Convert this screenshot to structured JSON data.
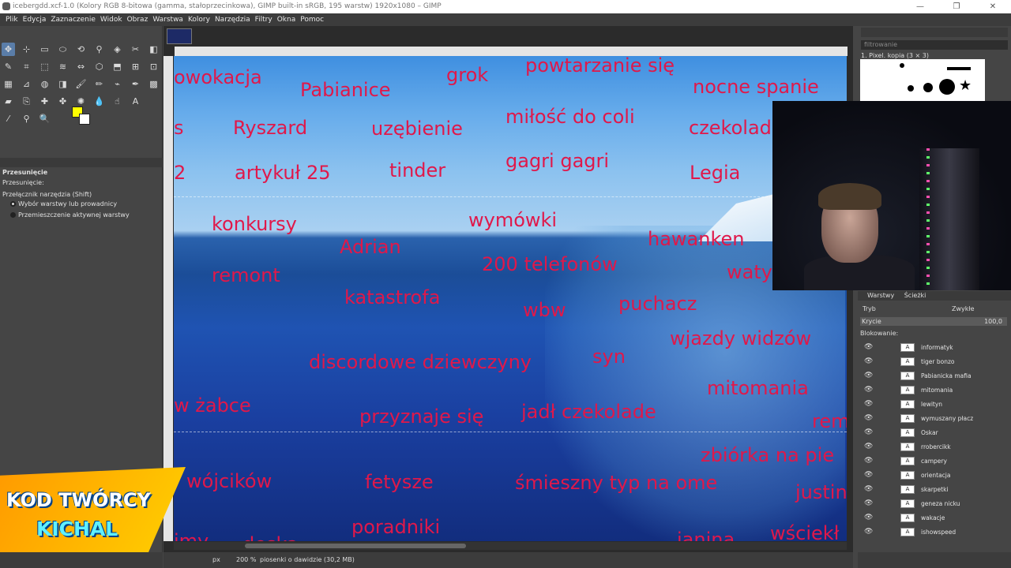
{
  "window": {
    "title": "icebergdd.xcf-1.0 (Kolory RGB 8-bitowa (gamma, stałoprzecinkowa), GIMP built-in sRGB, 195 warstw) 1920x1080 – GIMP",
    "minimize": "—",
    "maximize": "❐",
    "close": "✕"
  },
  "menu": [
    "Plik",
    "Edycja",
    "Zaznaczenie",
    "Widok",
    "Obraz",
    "Warstwa",
    "Kolory",
    "Narzędzia",
    "Filtry",
    "Okna",
    "Pomoc"
  ],
  "tool_options": {
    "title": "Przesunięcie",
    "move_label": "Przesunięcie:",
    "toggle_label": "Przełącznik narzędzia  (Shift)",
    "option1": "Wybór warstwy lub prowadnicy",
    "option2": "Przemieszczenie aktywnej warstwy"
  },
  "colors": {
    "foreground": "#ffff00",
    "background": "#ffffff",
    "text_red": "#e0184a"
  },
  "canvas_words": [
    {
      "t": "owokacja",
      "size": 24
    },
    {
      "t": "Pabianice",
      "size": 24
    },
    {
      "t": "grok",
      "size": 24
    },
    {
      "t": "powtarzanie się",
      "size": 24
    },
    {
      "t": "nocne spanie",
      "size": 24
    },
    {
      "t": "s",
      "size": 24
    },
    {
      "t": "Ryszard",
      "size": 24
    },
    {
      "t": "uzębienie",
      "size": 24
    },
    {
      "t": "miłość do coli",
      "size": 24
    },
    {
      "t": "czekolad",
      "size": 24
    },
    {
      "t": "2",
      "size": 24
    },
    {
      "t": "artykuł 25",
      "size": 24
    },
    {
      "t": "tinder",
      "size": 24
    },
    {
      "t": "gagri gagri",
      "size": 24
    },
    {
      "t": "Legia",
      "size": 24
    },
    {
      "t": "konkursy",
      "size": 24
    },
    {
      "t": "wymówki",
      "size": 24
    },
    {
      "t": "hawanken",
      "size": 24
    },
    {
      "t": "Adrian",
      "size": 24
    },
    {
      "t": "200 telefonów",
      "size": 24
    },
    {
      "t": "remont",
      "size": 24
    },
    {
      "t": "waty",
      "size": 24
    },
    {
      "t": "katastrofa",
      "size": 24
    },
    {
      "t": "wbw",
      "size": 24
    },
    {
      "t": "puchacz",
      "size": 24
    },
    {
      "t": "wjazdy widzów",
      "size": 24
    },
    {
      "t": "discordowe dziewczyny",
      "size": 24
    },
    {
      "t": "syn",
      "size": 24
    },
    {
      "t": "mitomania",
      "size": 24
    },
    {
      "t": "w żabce",
      "size": 24
    },
    {
      "t": "przyznaje się",
      "size": 24
    },
    {
      "t": "jadł czekolade",
      "size": 24
    },
    {
      "t": "rem",
      "size": 24
    },
    {
      "t": "zbiórka na pie",
      "size": 24
    },
    {
      "t": "wójcików",
      "size": 24
    },
    {
      "t": "fetysze",
      "size": 24
    },
    {
      "t": "śmieszny typ na ome",
      "size": 24
    },
    {
      "t": "justin",
      "size": 24
    },
    {
      "t": "poradniki",
      "size": 24
    },
    {
      "t": "wściekł",
      "size": 24
    },
    {
      "t": "imy",
      "size": 24
    },
    {
      "t": "deska",
      "size": 24
    },
    {
      "t": "janina",
      "size": 24
    }
  ],
  "brushes": {
    "filter_placeholder": "filtrowanie",
    "current": "1. Pixel. kopia (3 × 3)"
  },
  "layers_panel": {
    "tabs": [
      "Warstwy",
      "Ścieżki"
    ],
    "mode_label": "Tryb",
    "mode_value": "Zwykłe",
    "opacity_label": "Krycie",
    "opacity_value": "100,0",
    "lock_label": "Blokowanie:",
    "layers": [
      "informatyk",
      "tiger bonzo",
      "Pabianicka mafia",
      "mitomania",
      "lewityn",
      "wymuszany płacz",
      "Oskar",
      "rrobercikk",
      "campery",
      "orientacja",
      "skarpetki",
      "geneza nicku",
      "wakacje",
      "ishowspeed"
    ]
  },
  "status": {
    "unit": "px",
    "zoom": "200 %",
    "info": "piosenki o dawidzie (30,2 MB)"
  },
  "promo": {
    "line1": "KOD TWÓRCY",
    "line2": "KICHAL"
  }
}
